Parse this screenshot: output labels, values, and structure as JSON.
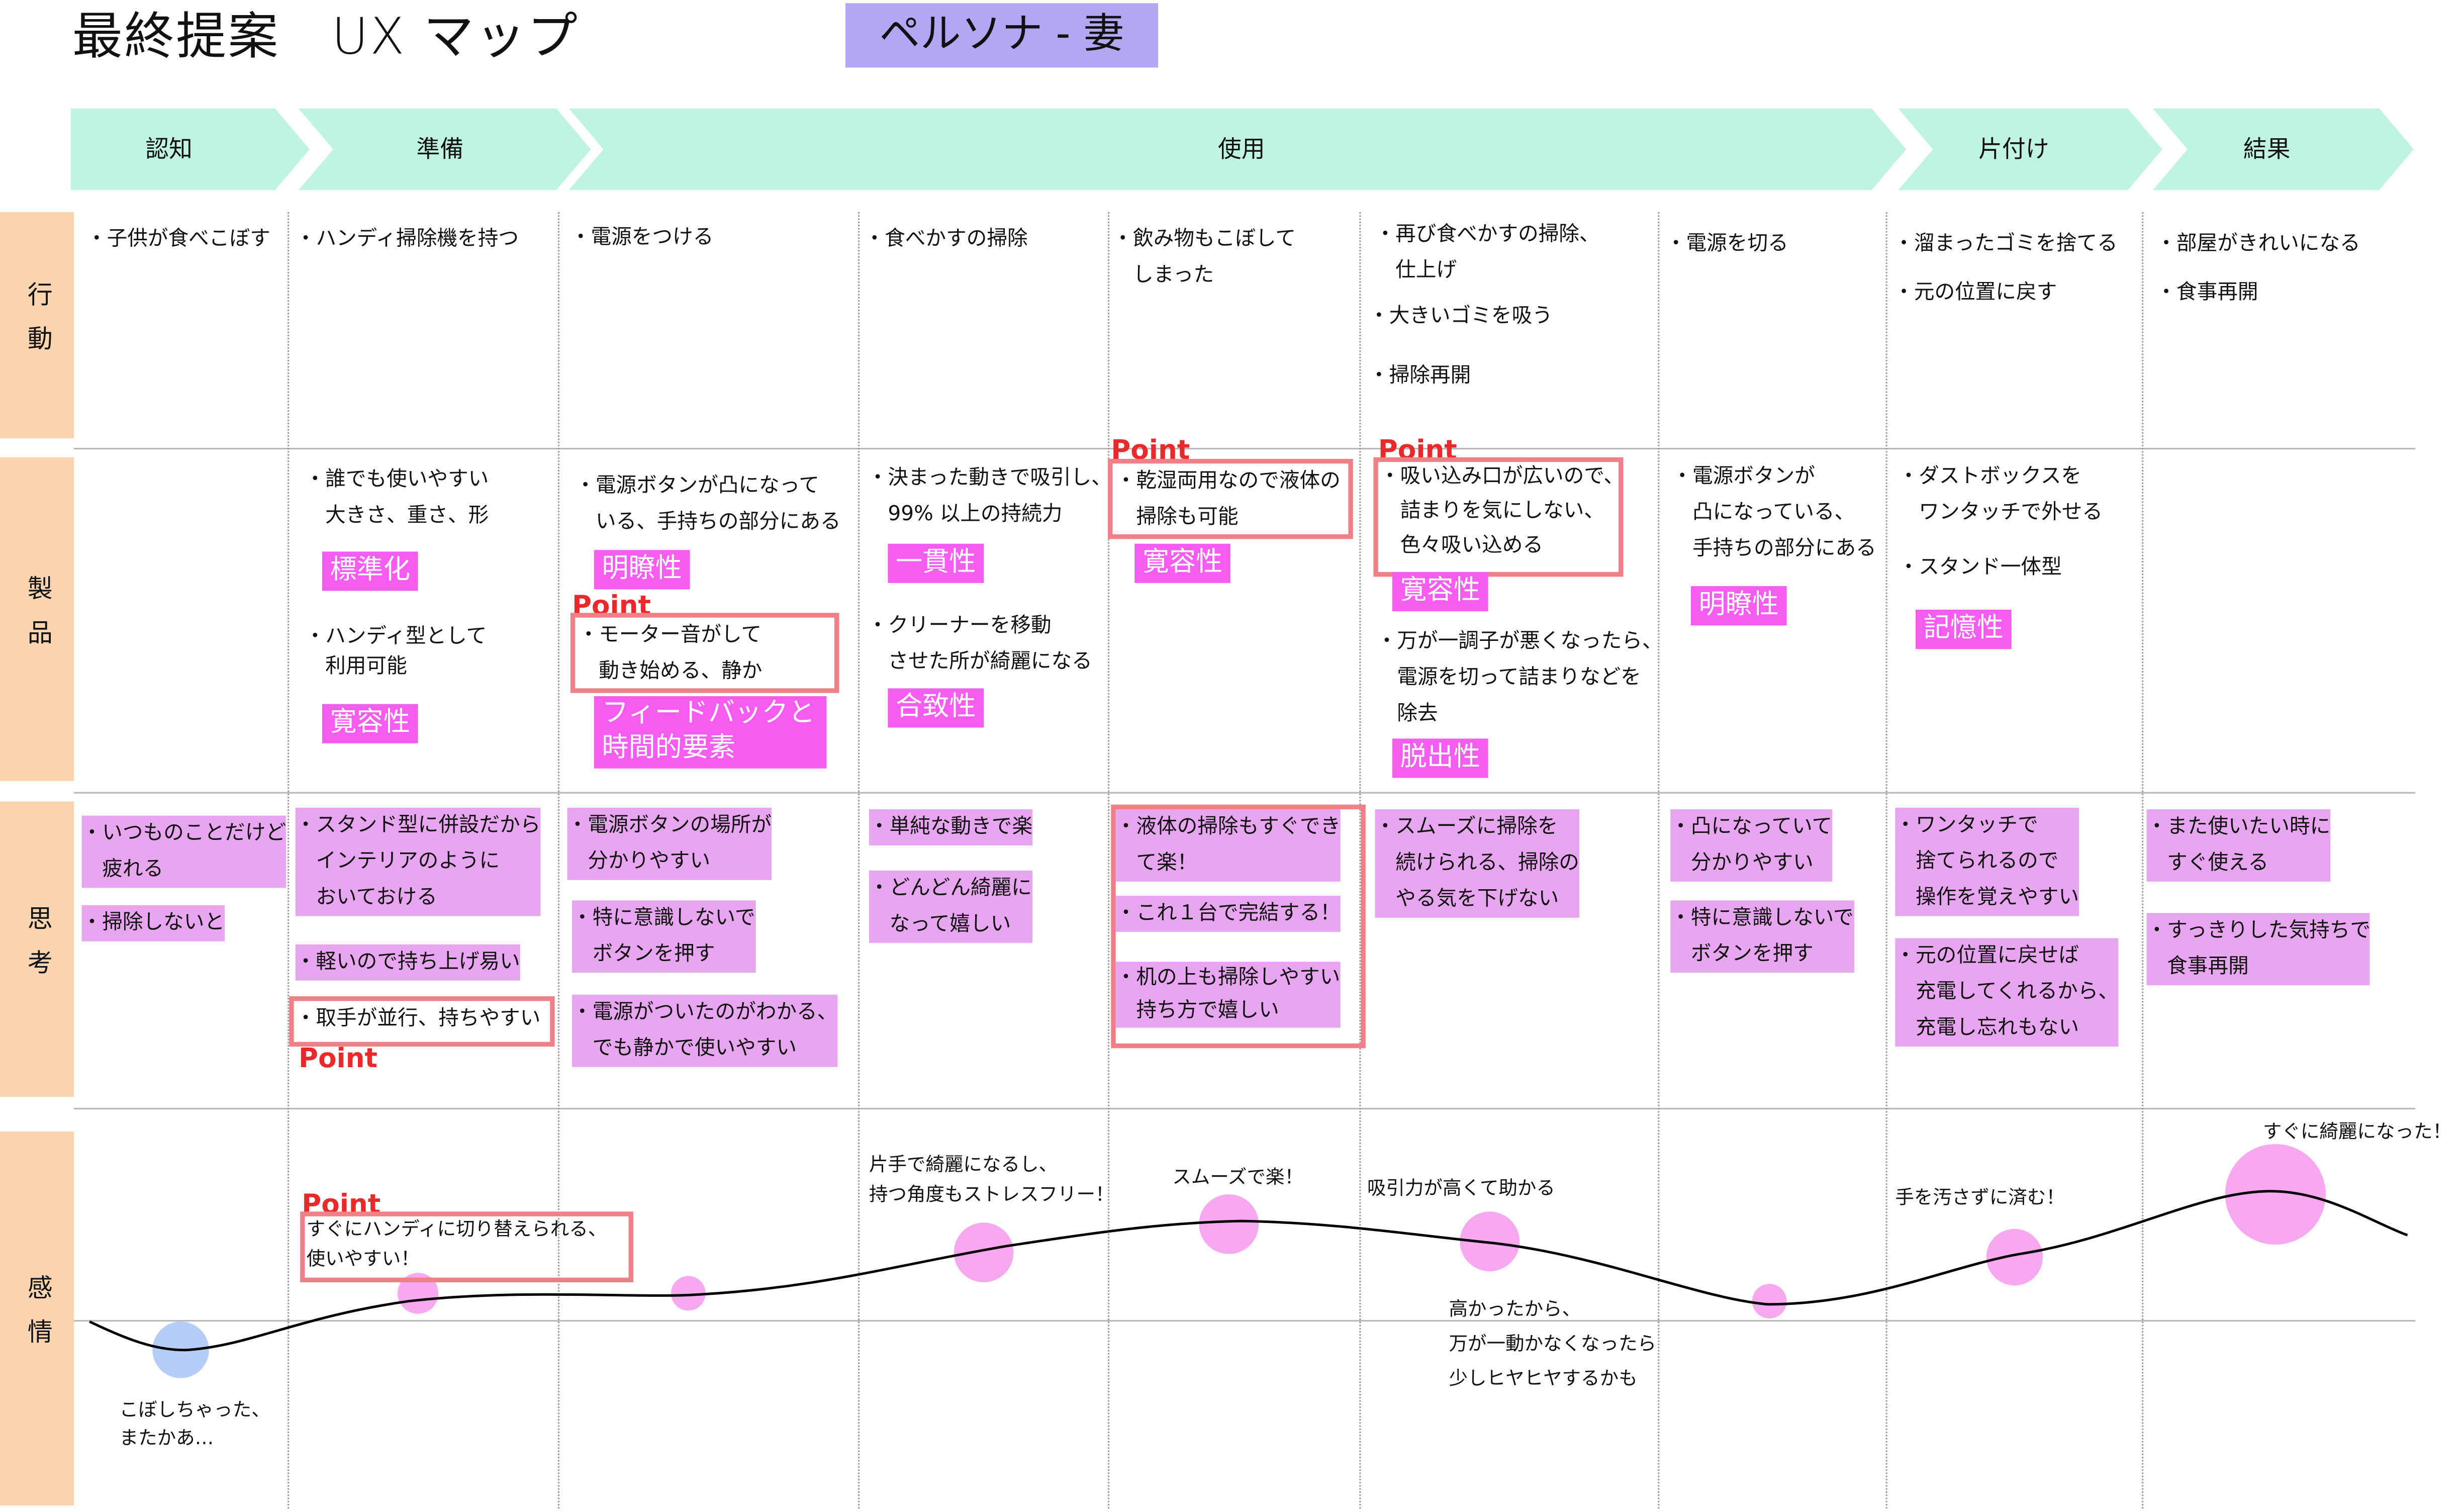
{
  "title": "最終提案　UX マップ",
  "persona": "ペルソナ - 妻",
  "colors": {
    "phase": "#bff3e4",
    "row_header": "#fbd4b1",
    "persona": "#b4a6f5",
    "tag": "#f55df0",
    "point_box": "#f07f87",
    "point_text": "#ea2a2a",
    "bubble_pink": "#f6a9ef",
    "bubble_blue": "#b6cdf7",
    "underline": "#e8a6f0"
  },
  "phases": [
    "認知",
    "準備",
    "使用",
    "片付け",
    "結果"
  ],
  "rows": [
    "行動",
    "製品",
    "思考",
    "感情"
  ],
  "point_label": "Point",
  "actions": [
    [
      "・子供が食べこぼす"
    ],
    [
      "・ハンディ掃除機を持つ"
    ],
    [
      "・電源をつける"
    ],
    [
      "・食べかすの掃除"
    ],
    [
      "・飲み物もこぼして",
      "　しまった"
    ],
    [
      "・再び食べかすの掃除、",
      "　仕上げ",
      "・大きいゴミを吸う",
      "・掃除再開"
    ],
    [
      "・電源を切る"
    ],
    [
      "・溜まったゴミを捨てる",
      "・元の位置に戻す"
    ],
    [
      "・部屋がきれいになる",
      "・食事再開"
    ]
  ],
  "product": {
    "c1_a": "・誰でも使いやすい\n　大きさ、重さ、形",
    "c1_tag1": "標準化",
    "c1_b": "・ハンディ型として\n　利用可能",
    "c1_tag2": "寛容性",
    "c2_a": "・電源ボタンが凸になって\n　いる、手持ちの部分にある",
    "c2_tag1": "明瞭性",
    "c2_b": "・モーター音がして\n　動き始める、静か",
    "c2_tag2": "フィードバックと\n時間的要素",
    "c3_a": "・決まった動きで吸引し、\n　99% 以上の持続力",
    "c3_tag1": "一貫性",
    "c3_b": "・クリーナーを移動\n　させた所が綺麗になる",
    "c3_tag2": "合致性",
    "c4_a": "・乾湿両用なので液体の\n　掃除も可能",
    "c4_tag1": "寛容性",
    "c5_a": "・吸い込み口が広いので、\n　詰まりを気にしない、\n　色々吸い込める",
    "c5_tag1": "寛容性",
    "c5_b": "・万が一調子が悪くなったら、\n　電源を切って詰まりなどを\n　除去",
    "c5_tag2": "脱出性",
    "c6_a": "・電源ボタンが\n　凸になっている、\n　手持ちの部分にある",
    "c6_tag1": "明瞭性",
    "c7_a": "・ダストボックスを\n　ワンタッチで外せる",
    "c7_b": "・スタンド一体型",
    "c7_tag1": "記憶性"
  },
  "thoughts": {
    "c0_a": "・いつものことだけど\n　疲れる",
    "c0_b": "・掃除しないと",
    "c1_a": "・スタンド型に併設だから\n　インテリアのように\n　おいておける",
    "c1_b": "・軽いので持ち上げ易い",
    "c1_c": "・取手が並行、持ちやすい",
    "c2_a": "・電源ボタンの場所が\n　分かりやすい",
    "c2_b": "・特に意識しないで\n　ボタンを押す",
    "c2_c": "・電源がついたのがわかる、\n　でも静かで使いやすい",
    "c3_a": "・単純な動きで楽",
    "c3_b": "・どんどん綺麗に\n　なって嬉しい",
    "c4_a": "・液体の掃除もすぐでき\n　て楽！",
    "c4_b": "・これ１台で完結する！",
    "c4_c": "・机の上も掃除しやすい\n　持ち方で嬉しい",
    "c5_a": "・スムーズに掃除を\n　続けられる、掃除の\n　やる気を下げない",
    "c6_a": "・凸になっていて\n　分かりやすい",
    "c6_b": "・特に意識しないで\n　ボタンを押す",
    "c7_a": "・ワンタッチで\n　捨てられるので\n　操作を覚えやすい",
    "c7_b": "・元の位置に戻せば\n　充電してくれるから、\n　充電し忘れもない",
    "c8_a": "・また使いたい時に\n　すぐ使える",
    "c8_b": "・すっきりした気持ちで\n　食事再開"
  },
  "emotions": {
    "e0": "こぼしちゃった、\nまたかあ…",
    "e1": "すぐにハンディに切り替えられる、\n使いやすい！",
    "e3": "片手で綺麗になるし、\n持つ角度もストレスフリー！",
    "e4": "スムーズで楽！",
    "e5a": "吸引力が高くて助かる",
    "e5b": "高かったから、\n万が一動かなくなったら\n少しヒヤヒヤするかも",
    "e7": "手を汚さずに済む！",
    "e8": "すぐに綺麗になった！"
  }
}
